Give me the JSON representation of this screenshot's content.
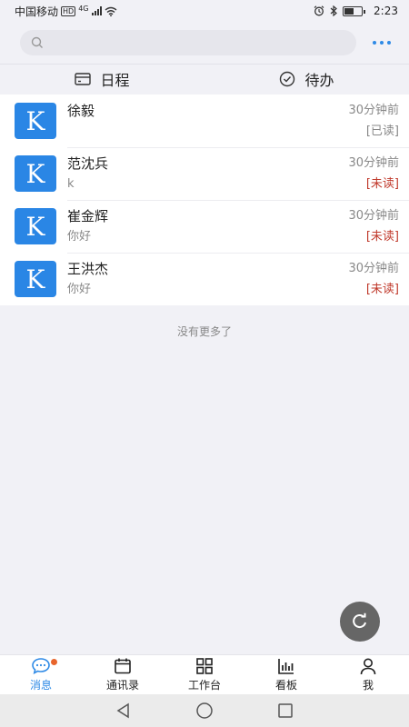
{
  "status_bar": {
    "carrier": "中国移动",
    "hd": "HD",
    "network": "4G",
    "time": "2:23"
  },
  "search": {
    "placeholder": ""
  },
  "tabs": [
    {
      "label": "日程",
      "icon": "card-icon"
    },
    {
      "label": "待办",
      "icon": "check-circle-icon"
    }
  ],
  "messages": [
    {
      "avatar": "K",
      "name": "徐毅",
      "preview": "",
      "time": "30分钟前",
      "status": "[已读]",
      "read": true
    },
    {
      "avatar": "K",
      "name": "范沈兵",
      "preview": "k",
      "time": "30分钟前",
      "status": "[未读]",
      "read": false
    },
    {
      "avatar": "K",
      "name": "崔金辉",
      "preview": "你好",
      "time": "30分钟前",
      "status": "[未读]",
      "read": false
    },
    {
      "avatar": "K",
      "name": "王洪杰",
      "preview": "你好",
      "time": "30分钟前",
      "status": "[未读]",
      "read": false
    }
  ],
  "list_footer": "没有更多了",
  "bottom_tabs": [
    {
      "label": "消息",
      "icon": "message-icon",
      "active": true,
      "badge": true
    },
    {
      "label": "通讯录",
      "icon": "calendar-icon",
      "active": false
    },
    {
      "label": "工作台",
      "icon": "grid-icon",
      "active": false
    },
    {
      "label": "看板",
      "icon": "bar-chart-icon",
      "active": false
    },
    {
      "label": "我",
      "icon": "person-icon",
      "active": false
    }
  ],
  "colors": {
    "accent": "#2e8ae6",
    "unread": "#c0392b",
    "avatar_bg": "#2a86e5",
    "badge": "#e8652c"
  }
}
